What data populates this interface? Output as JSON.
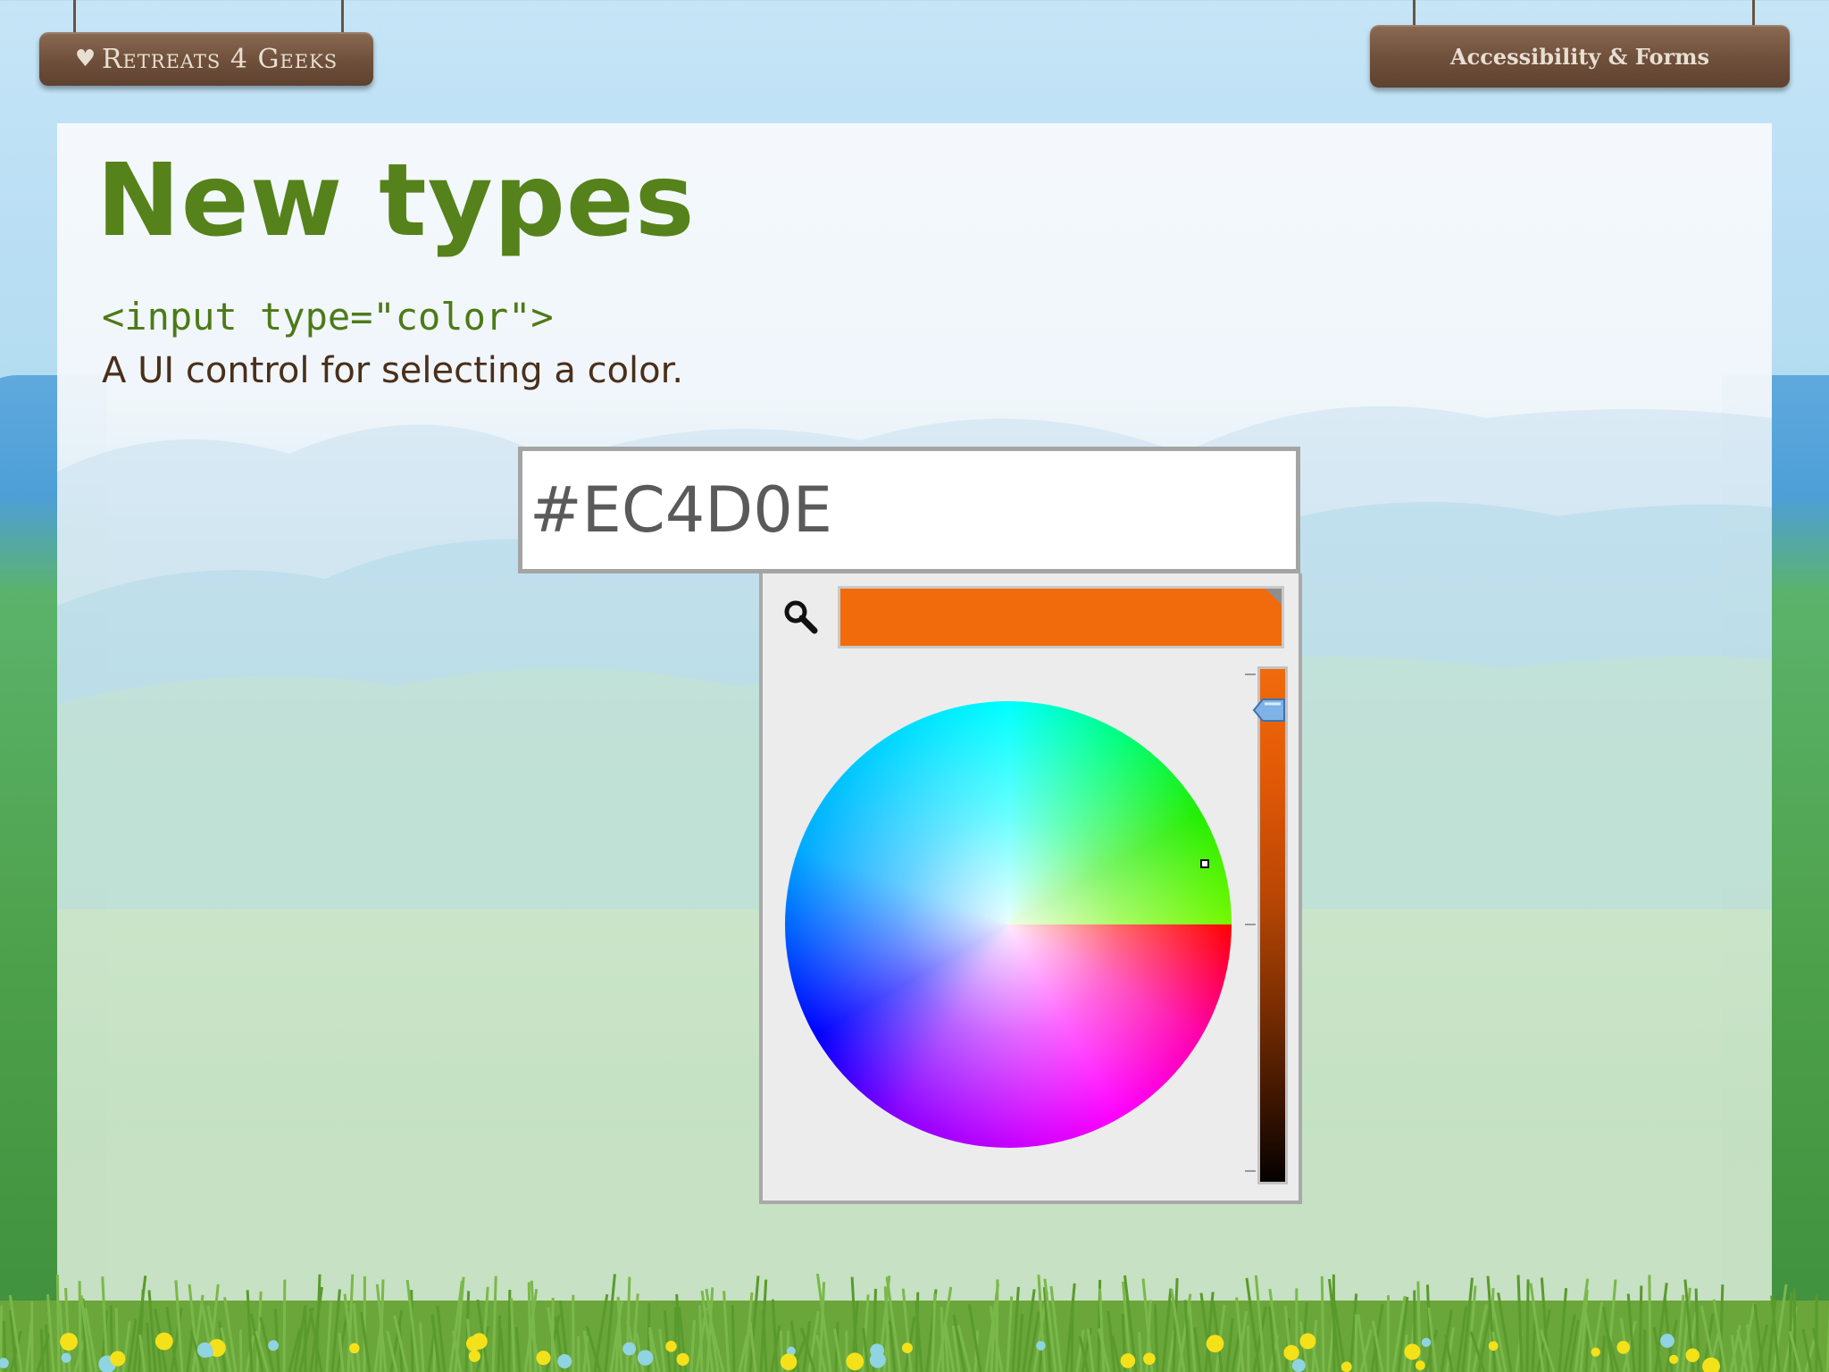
{
  "header": {
    "brand_sign": "Retreats 4 Geeks",
    "section_sign": "Accessibility & Forms",
    "brand_icon": "heart-icon"
  },
  "slide": {
    "title": "New types",
    "code": "<input type=\"color\">",
    "description": "A UI control for selecting a color."
  },
  "color_input": {
    "value": "#EC4D0E"
  },
  "color_picker": {
    "selected_color": "#f16a0c",
    "search_icon": "magnifier-icon",
    "slider_icon": "slider-thumb-icon"
  }
}
